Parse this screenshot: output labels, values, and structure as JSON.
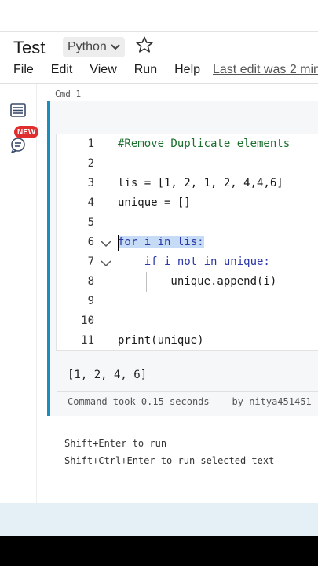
{
  "notebook": {
    "title": "Test",
    "language": "Python"
  },
  "menu": [
    "File",
    "Edit",
    "View",
    "Run",
    "Help"
  ],
  "last_edit": "Last edit was 2 min",
  "cell": {
    "label": "Cmd 1",
    "lines": [
      {
        "num": "1",
        "text": "#Remove Duplicate elements"
      },
      {
        "num": "2",
        "text": ""
      },
      {
        "num": "3",
        "text": "lis = [1, 2, 1, 2, 4,4,6]"
      },
      {
        "num": "4",
        "text": "unique = []"
      },
      {
        "num": "5",
        "text": ""
      },
      {
        "num": "6",
        "text": "for i in lis:"
      },
      {
        "num": "7",
        "text": "    if i not in unique:"
      },
      {
        "num": "8",
        "text": "        unique.append(i)"
      },
      {
        "num": "9",
        "text": ""
      },
      {
        "num": "10",
        "text": ""
      },
      {
        "num": "11",
        "text": "print(unique)"
      }
    ],
    "output": "[1, 2, 4, 6]",
    "status": "Command took 0.15 seconds -- by nitya451451"
  },
  "hints": [
    "Shift+Enter to run",
    "Shift+Ctrl+Enter to run selected text"
  ],
  "sidebar": {
    "new_badge": "NEW"
  },
  "colors": {
    "accent": "#1a8fbf",
    "keyword": "#2a37a8",
    "comment": "#1b6e2d",
    "selection": "#c6dcf6",
    "badge": "#e02d2d"
  }
}
